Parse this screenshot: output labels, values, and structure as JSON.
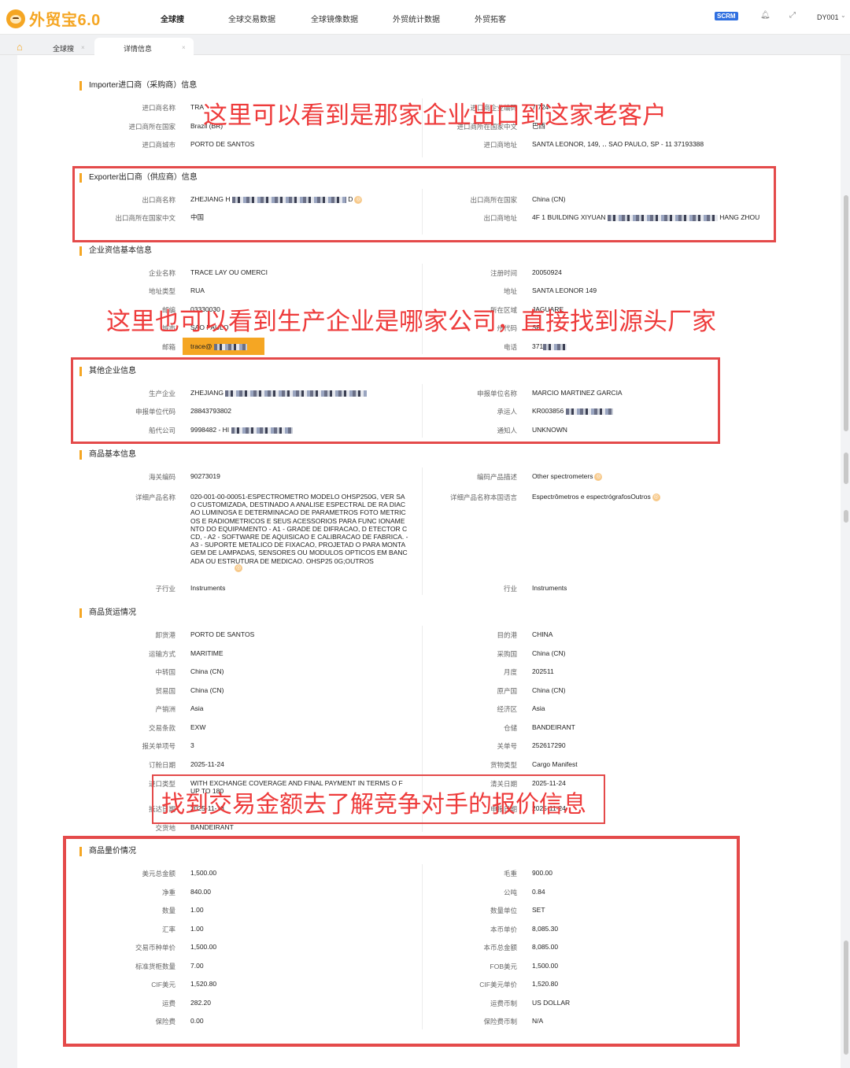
{
  "app": {
    "logo_text": "外贸宝6.0"
  },
  "nav": {
    "items": [
      "全球搜",
      "全球交易数据",
      "全球镜像数据",
      "外贸统计数据",
      "外贸拓客"
    ],
    "active": "全球搜",
    "scrm": "SCRM",
    "user": "DY001"
  },
  "tabs": [
    {
      "label": "全球搜",
      "active": false
    },
    {
      "label": "详情信息",
      "active": true
    }
  ],
  "sections": {
    "importer": {
      "title": "Importer进口商（采购商）信息",
      "rows": [
        {
          "l_label": "进口商名称",
          "l_value": "TRA",
          "r_label": "进口商企业编码",
          "r_value": "7,724"
        },
        {
          "l_label": "进口商所在国家",
          "l_value": "Brazil (BR)",
          "r_label": "进口商所在国家中文",
          "r_value": "巴西"
        },
        {
          "l_label": "进口商城市",
          "l_value": "PORTO DE SANTOS",
          "r_label": "进口商地址",
          "r_value": "SANTA LEONOR, 149, ‥ SAO PAULO, SP - 11 37193388"
        }
      ]
    },
    "exporter": {
      "title": "Exporter出口商（供应商）信息",
      "rows": [
        {
          "l_label": "出口商名称",
          "l_value": "ZHEJIANG H",
          "l_suffix": "D",
          "r_label": "出口商所在国家",
          "r_value": "China (CN)"
        },
        {
          "l_label": "出口商所在国家中文",
          "l_value": "中国",
          "r_label": "出口商地址",
          "r_value": "4F 1 BUILDING XIYUAN",
          "r_value2": "HANG ZHOU"
        }
      ]
    },
    "company": {
      "title": "企业资信基本信息",
      "rows": [
        {
          "l_label": "企业名称",
          "l_value": "TRACE LAY OU   OMERCI",
          "r_label": "注册时间",
          "r_value": "20050924"
        },
        {
          "l_label": "地址类型",
          "l_value": "RUA",
          "r_label": "地址",
          "r_value": "SANTA LEONOR 149"
        },
        {
          "l_label": "邮编",
          "l_value": "03330030",
          "r_label": "所在区域",
          "r_value": "JAGUARE"
        },
        {
          "l_label": "城市",
          "l_value": "SAO PAULO",
          "r_label": "州代码",
          "r_value": "SP"
        },
        {
          "l_label": "邮箱",
          "l_value": "trace@",
          "r_label": "电话",
          "r_value": "371"
        }
      ]
    },
    "other": {
      "title": "其他企业信息",
      "rows": [
        {
          "l_label": "生产企业",
          "l_value": "ZHEJIANG",
          "r_label": "申报单位名称",
          "r_value": "MARCIO MARTINEZ GARCIA"
        },
        {
          "l_label": "申报单位代码",
          "l_value": "28843793802",
          "r_label": "承运人",
          "r_value": "KR003856"
        },
        {
          "l_label": "船代公司",
          "l_value": "9998482 - HI",
          "r_label": "通知人",
          "r_value": "UNKNOWN"
        }
      ]
    },
    "goods": {
      "title": "商品基本信息",
      "rows": [
        {
          "l_label": "海关编码",
          "l_value": "90273019",
          "r_label": "编码产品描述",
          "r_value": "Other spectrometers"
        },
        {
          "l_label": "详细产品名称",
          "l_value": "020-001-00-00051-ESPECTROMETRO MODELO OHSP250G, VER SAO CUSTOMIZADA, DESTINADO A ANALISE ESPECTRAL DE RA DIACAO LUMINOSA E DETERMINACAO DE PARAMETROS FOTO METRICOS E RADIOMETRICOS E SEUS ACESSORIOS PARA FUNC IONAMENTO DO EQUIPAMENTO - A1 - GRADE DE DIFRACAO, D ETECTOR CCD, - A2 - SOFTWARE DE AQUISICAO E CALIBRACAO DE FABRICA. - A3 - SUPORTE METALICO DE FIXACAO, PROJETAD O PARA MONTAGEM DE LAMPADAS, SENSORES OU MODULOS OPTICOS EM BANCADA OU ESTRUTURA DE MEDICAO. OHSP25 0G;OUTROS",
          "r_label": "详细产品名称本国语言",
          "r_value": "Espectrômetros e espectrógrafosOutros"
        },
        {
          "l_label": "子行业",
          "l_value": "Instruments",
          "r_label": "行业",
          "r_value": "Instruments"
        }
      ]
    },
    "shipping": {
      "title": "商品货运情况",
      "rows": [
        {
          "l_label": "卸货港",
          "l_value": "PORTO DE SANTOS",
          "r_label": "目的港",
          "r_value": "CHINA"
        },
        {
          "l_label": "运输方式",
          "l_value": "MARITIME",
          "r_label": "采购国",
          "r_value": "China (CN)"
        },
        {
          "l_label": "中转国",
          "l_value": "China (CN)",
          "r_label": "月度",
          "r_value": "202511"
        },
        {
          "l_label": "贸易国",
          "l_value": "China (CN)",
          "r_label": "原产国",
          "r_value": "China (CN)"
        },
        {
          "l_label": "产销洲",
          "l_value": "Asia",
          "r_label": "经济区",
          "r_value": "Asia"
        },
        {
          "l_label": "交易条款",
          "l_value": "EXW",
          "r_label": "仓储",
          "r_value": "BANDEIRANT"
        },
        {
          "l_label": "报关单项号",
          "l_value": "3",
          "r_label": "关单号",
          "r_value": "252617290"
        },
        {
          "l_label": "订舱日期",
          "l_value": "2025-11-24",
          "r_label": "货物类型",
          "r_value": "Cargo Manifest"
        },
        {
          "l_label": "进口类型",
          "l_value": "WITH EXCHANGE COVERAGE AND FINAL PAYMENT IN TERMS O F UP TO 180",
          "r_label": "清关日期",
          "r_value": "2025-11-24"
        },
        {
          "l_label": "抵达日期",
          "l_value": "2025-11-13",
          "r_label": "申报日期",
          "r_value": "2025-11-24"
        },
        {
          "l_label": "交货地",
          "l_value": "BANDEIRANT",
          "r_label": "",
          "r_value": ""
        }
      ]
    },
    "price": {
      "title": "商品量价情况",
      "rows": [
        {
          "l_label": "美元总金额",
          "l_value": "1,500.00",
          "r_label": "毛重",
          "r_value": "900.00"
        },
        {
          "l_label": "净重",
          "l_value": "840.00",
          "r_label": "公吨",
          "r_value": "0.84"
        },
        {
          "l_label": "数量",
          "l_value": "1.00",
          "r_label": "数量单位",
          "r_value": "SET"
        },
        {
          "l_label": "汇率",
          "l_value": "1.00",
          "r_label": "本币单价",
          "r_value": "8,085.30"
        },
        {
          "l_label": "交易币种单价",
          "l_value": "1,500.00",
          "r_label": "本币总金额",
          "r_value": "8,085.00"
        },
        {
          "l_label": "标准货柜数量",
          "l_value": "7.00",
          "r_label": "FOB美元",
          "r_value": "1,500.00"
        },
        {
          "l_label": "CIF美元",
          "l_value": "1,520.80",
          "r_label": "CIF美元单价",
          "r_value": "1,520.80"
        },
        {
          "l_label": "运费",
          "l_value": "282.20",
          "r_label": "运费币制",
          "r_value": "US DOLLAR"
        },
        {
          "l_label": "保险费",
          "l_value": "0.00",
          "r_label": "保险费币制",
          "r_value": "N/A"
        }
      ]
    }
  },
  "annotations": {
    "a1": "这里可以看到是那家企业出口到这家老客户",
    "a2": "这里也可以看到生产企业是哪家公司，直接找到源头厂家",
    "a3": "找到交易金额去了解竞争对手的报价信息"
  },
  "colors": {
    "accent": "#f5a623",
    "annotation": "#ee3b3b",
    "scrm": "#2f6fe0"
  }
}
